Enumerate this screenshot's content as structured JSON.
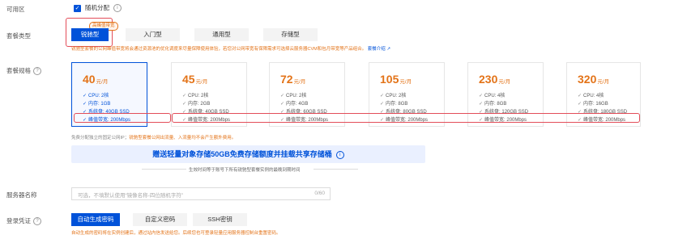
{
  "zone": {
    "label": "可用区",
    "checkbox_label": "随机分配"
  },
  "package_type": {
    "label": "套餐类型",
    "badge": "高峰值带宽",
    "tabs": [
      "锐驰型",
      "入门型",
      "通用型",
      "存储型"
    ],
    "active_index": 0,
    "note": "锐驰型套餐的公网峰值带宽将会通过资源池的优化调度来尽量保障使用体验，若您对公网带宽有保障需求可选择云服务器CVM和包月带宽等产品组合。",
    "note_link": "套餐介绍"
  },
  "package_spec": {
    "label": "套餐规格",
    "unit": "元/月",
    "cards": [
      {
        "price": "40",
        "specs": [
          "CPU: 2核",
          "内存: 1GB",
          "系统盘: 40GB SSD",
          "峰值带宽: 200Mbps"
        ]
      },
      {
        "price": "45",
        "specs": [
          "CPU: 2核",
          "内存: 2GB",
          "系统盘: 40GB SSD",
          "峰值带宽: 200Mbps"
        ]
      },
      {
        "price": "72",
        "specs": [
          "CPU: 2核",
          "内存: 4GB",
          "系统盘: 60GB SSD",
          "峰值带宽: 200Mbps"
        ]
      },
      {
        "price": "105",
        "specs": [
          "CPU: 2核",
          "内存: 8GB",
          "系统盘: 80GB SSD",
          "峰值带宽: 200Mbps"
        ]
      },
      {
        "price": "230",
        "specs": [
          "CPU: 4核",
          "内存: 8GB",
          "系统盘: 120GB SSD",
          "峰值带宽: 200Mbps"
        ]
      },
      {
        "price": "320",
        "specs": [
          "CPU: 4核",
          "内存: 16GB",
          "系统盘: 180GB SSD",
          "峰值带宽: 200Mbps"
        ]
      }
    ],
    "selected_index": 0,
    "note_prefix": "免费分配独立的固定公网IP；",
    "note_highlight": "锐驰型套餐公网出流量、入流量均不会产生额外费用。"
  },
  "promo": {
    "banner": "赠送轻量对象存储50GB免费存储额度并挂载共享存储桶",
    "caption": "生效时间等于账号下所有锐驰型套餐实例的最晚到期时间"
  },
  "server_name": {
    "label": "服务器名称",
    "placeholder": "可选，不填默认使用“镜像名称-四位随机字符”",
    "counter": "0/60"
  },
  "login": {
    "label": "登录凭证",
    "buttons": [
      "自动生成密码",
      "自定义密码",
      "SSH密钥"
    ],
    "active_index": 0,
    "note": "自动生成的密码将在实例创建后，通过站内信发送给您。后续您也可登录轻量应用服务器控制台重置密码。"
  },
  "colors": {
    "accent": "#0052d9",
    "price": "#e37318",
    "highlight_box": "#e34d59"
  }
}
